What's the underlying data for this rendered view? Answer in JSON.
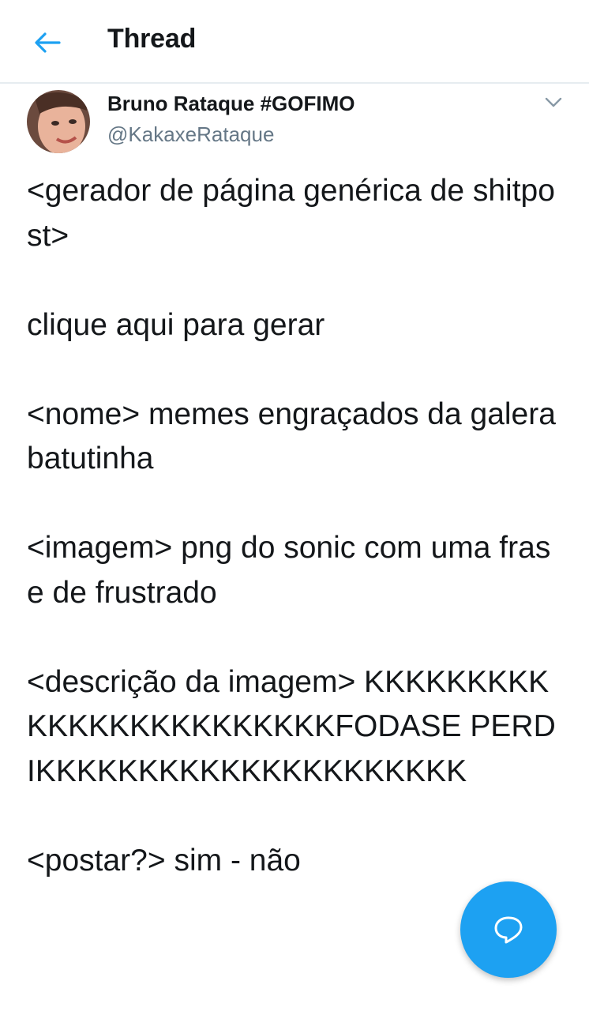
{
  "header": {
    "back_icon": "arrow-left-icon",
    "title": "Thread"
  },
  "tweet": {
    "author_name": "Bruno Rataque #GOFIMO",
    "author_handle": "@KakaxeRataque",
    "menu_icon": "chevron-down-icon",
    "text": "<gerador de página genérica de shitpost>\n\nclique aqui para gerar\n\n<nome> memes engraçados da galera batutinha\n\n<imagem> png do sonic com uma frase de frustrado\n\n<descrição da imagem> KKKKKKKKKKKKKKKKKKKKKKKKFODASE PERDIKKKKKKKKKKKKKKKKKKKKK\n\n<postar?> sim - não"
  },
  "fab": {
    "icon": "speech-bubble-icon"
  },
  "colors": {
    "accent": "#1da1f2",
    "text": "#14171a",
    "secondary_text": "#657786",
    "divider": "#e6ecf0"
  }
}
